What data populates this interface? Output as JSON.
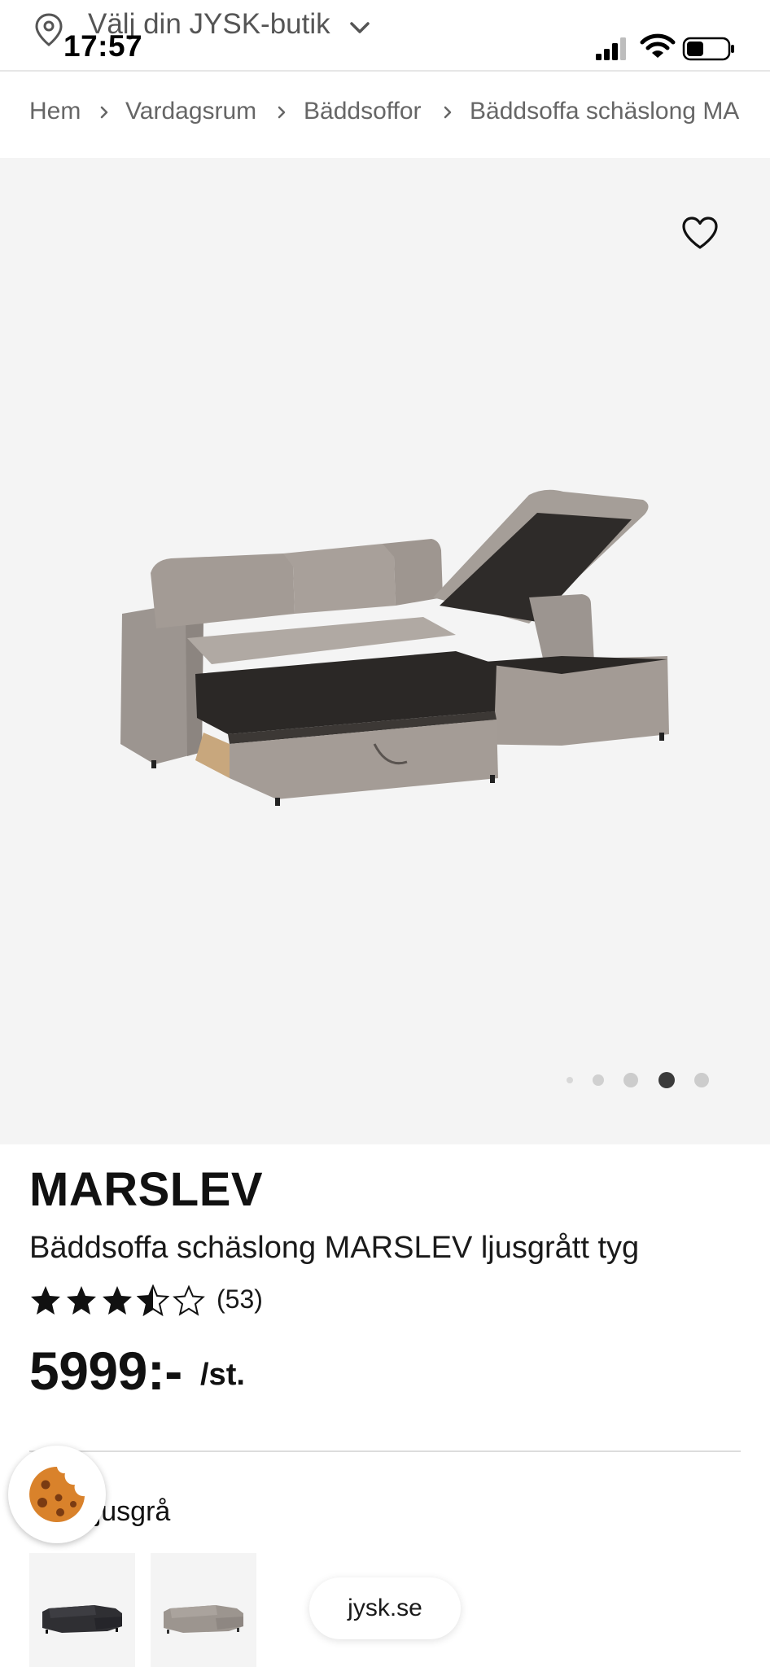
{
  "status_bar": {
    "time": "17:57"
  },
  "store_selector": {
    "label": "Välj din JYSK-butik"
  },
  "breadcrumb": {
    "items": [
      "Hem",
      "Vardagsrum",
      "Bäddsoffor",
      "Bäddsoffa schäslong MA"
    ]
  },
  "gallery": {
    "image_count": 5,
    "active_index": 3
  },
  "product": {
    "name": "MARSLEV",
    "description": "Bäddsoffa schäslong MARSLEV ljusgrått tyg",
    "rating": 3.5,
    "rating_max": 5,
    "review_count": "(53)",
    "price": "5999:-",
    "price_unit": "/st.",
    "color_label": "g. Ljusgrå"
  },
  "footer": {
    "url": "jysk.se"
  },
  "colors": {
    "background": "#ffffff",
    "gallery_bg": "#f4f4f4",
    "text": "#1a1a1a",
    "muted_text": "#666666",
    "cookie": "#d9822b"
  }
}
